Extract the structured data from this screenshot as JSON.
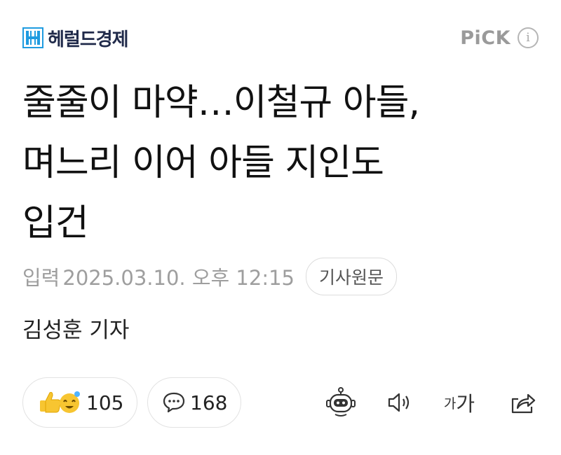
{
  "header": {
    "logo_text": "헤럴드경제",
    "pick_label": "PiCK",
    "info_icon": "i"
  },
  "article": {
    "headline_lines": [
      "줄줄이 마약…이철규 아들,",
      "며느리 이어 아들 지인도",
      "입건"
    ],
    "meta_label": "입력",
    "date": "2025.03.10. 오후 12:15",
    "original_button": "기사원문",
    "reporter": "김성훈 기자"
  },
  "actions": {
    "reaction_count": "105",
    "comment_count": "168",
    "font_small": "가",
    "font_big": "가"
  },
  "icons": {
    "logo": "herald-h-logo-icon",
    "info": "info-circle-icon",
    "reaction": "thumbs-up-emoji-icon",
    "comment": "speech-bubble-icon",
    "bot": "robot-summary-icon",
    "speaker": "speaker-icon",
    "share": "share-icon"
  },
  "colors": {
    "logo_blue": "#1f9be0",
    "logo_text": "#202a4a",
    "muted": "#9e9e9e",
    "emoji_yellow": "#f7c531"
  }
}
